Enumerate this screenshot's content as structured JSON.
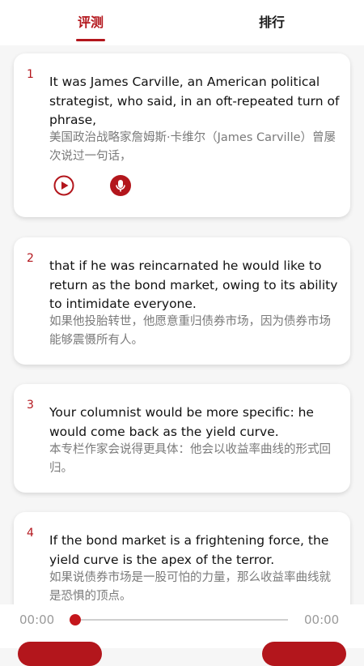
{
  "tabs": [
    {
      "label": "评测",
      "active": true
    },
    {
      "label": "排行",
      "active": false
    }
  ],
  "accent_color": "#b3161c",
  "sentences": [
    {
      "number": "1",
      "english": "It was James Carville, an American political strategist, who said, in an oft-repeated turn of phrase,",
      "chinese": "美国政治战略家詹姆斯·卡维尔（James Carville）曾屡次说过一句话，",
      "controls": [
        "play-icon",
        "microphone-icon"
      ]
    },
    {
      "number": "2",
      "english": "that if he was reincarnated he would like to return as the bond market, owing to its ability to intimidate everyone.",
      "chinese": "如果他投胎转世，他愿意重归债券市场，因为债券市场能够震慑所有人。"
    },
    {
      "number": "3",
      "english": "Your columnist would be more specific: he would come back as the yield curve.",
      "chinese": "本专栏作家会说得更具体：他会以收益率曲线的形式回归。"
    },
    {
      "number": "4",
      "english": "If the bond market is a frightening force, the yield curve is the apex of the terror.",
      "chinese": "如果说债券市场是一股可怕的力量，那么收益率曲线就是恐惧的顶点。"
    }
  ],
  "player": {
    "current_time": "00:00",
    "total_time": "00:00",
    "progress": 0
  }
}
